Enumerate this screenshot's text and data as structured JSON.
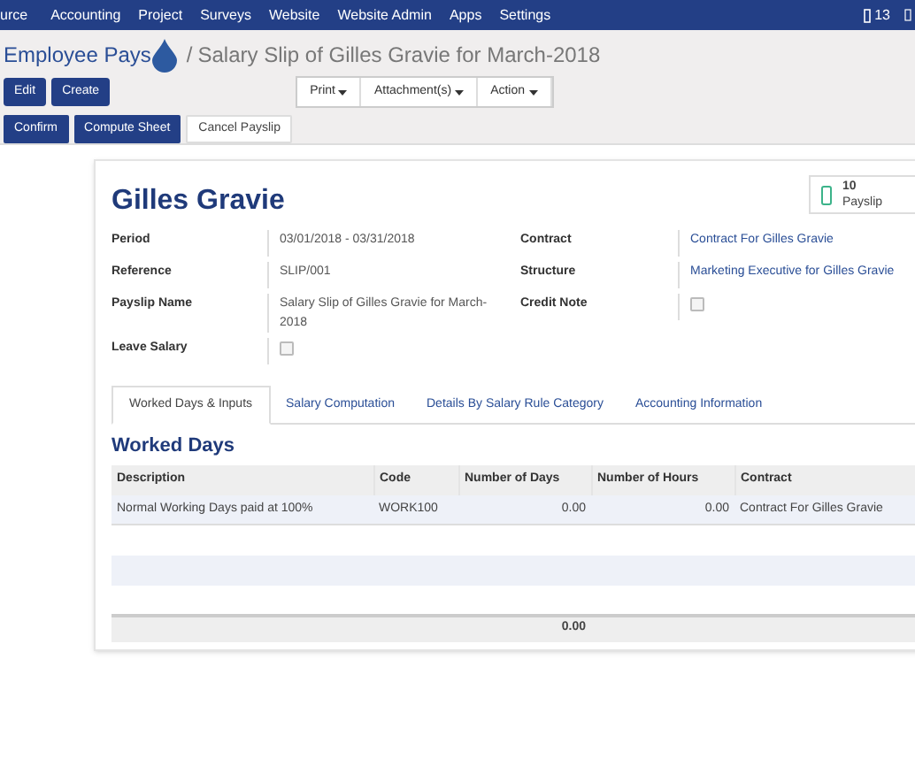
{
  "menu": [
    "urce",
    "Accounting",
    "Project",
    "Surveys",
    "Website",
    "Website Admin",
    "Apps",
    "Settings"
  ],
  "notification_count": "13",
  "breadcrumb": {
    "parent": "Employee Pays",
    "separator": "/",
    "current": "Salary Slip of Gilles Gravie for March-2018"
  },
  "buttons": [
    "Edit",
    "Create"
  ],
  "dropdowns": [
    "Print",
    "Attachment(s)",
    "Action"
  ],
  "status_buttons": [
    {
      "label": "Confirm",
      "primary": true
    },
    {
      "label": "Compute Sheet",
      "primary": true
    },
    {
      "label": "Cancel Payslip",
      "primary": false
    }
  ],
  "employee_name": "Gilles Gravie",
  "smart_button": {
    "count": "10",
    "label": "Payslip"
  },
  "left_fields": [
    {
      "label": "Period",
      "kind": "text",
      "value": "03/01/2018 - 03/31/2018"
    },
    {
      "label": "Reference",
      "kind": "text",
      "value": "SLIP/001"
    },
    {
      "label": "Payslip Name",
      "kind": "text",
      "value": "Salary Slip of Gilles Gravie for March-2018"
    },
    {
      "label": "Leave Salary",
      "kind": "checkbox",
      "checked": false
    }
  ],
  "right_fields": [
    {
      "label": "Contract",
      "kind": "link",
      "value": "Contract For Gilles Gravie"
    },
    {
      "label": "Structure",
      "kind": "link",
      "value": "Marketing Executive for Gilles Gravie"
    },
    {
      "label": "Credit Note",
      "kind": "checkbox",
      "checked": false
    }
  ],
  "tabs": [
    {
      "label": "Worked Days & Inputs",
      "selected": true
    },
    {
      "label": "Salary Computation",
      "selected": false
    },
    {
      "label": "Details By Salary Rule Category",
      "selected": false
    },
    {
      "label": "Accounting Information",
      "selected": false
    }
  ],
  "section_title": "Worked Days",
  "table": {
    "columns": [
      "Description",
      "Code",
      "Number of Days",
      "Number of Hours",
      "Contract"
    ],
    "rows": [
      [
        "Normal Working Days paid at 100%",
        "WORK100",
        "0.00",
        "0.00",
        "Contract For Gilles Gravie"
      ]
    ],
    "total": "0.00"
  }
}
